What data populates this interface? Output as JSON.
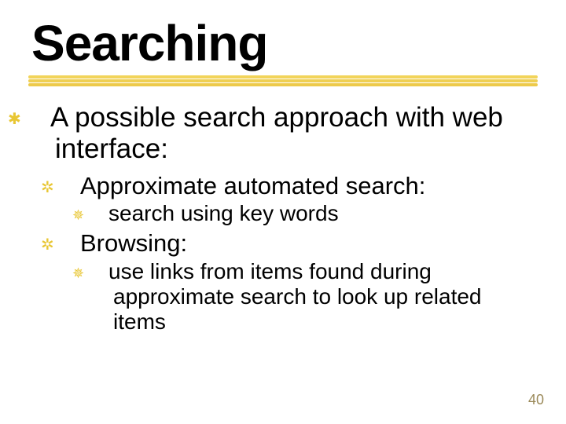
{
  "title": "Searching",
  "bullets": {
    "l1_icon": "✱",
    "l1_text": "A possible search approach with web interface:",
    "l2a_icon": "✲",
    "l2a_text": "Approximate automated search:",
    "l3a_icon": "✵",
    "l3a_text": "search using key words",
    "l2b_icon": "✲",
    "l2b_text": "Browsing:",
    "l3b_icon": "✵",
    "l3b_text": "use links from items found during approximate search to look up related items"
  },
  "page_number": "40"
}
